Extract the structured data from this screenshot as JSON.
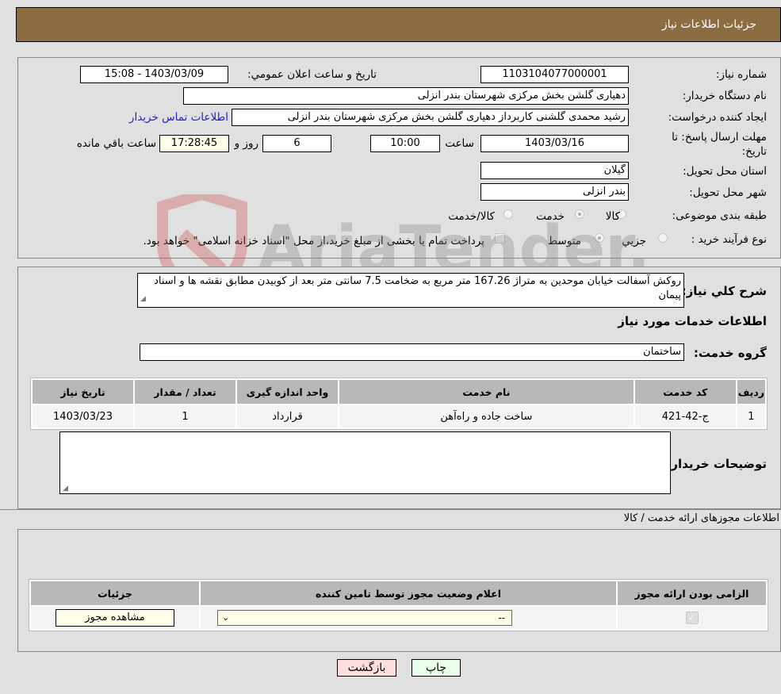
{
  "header": {
    "title": "جزئیات اطلاعات نیاز"
  },
  "info": {
    "need_number_label": "شماره نیاز:",
    "need_number": "1103104077000001",
    "announce_label": "تاريخ و ساعت اعلان عمومي:",
    "announce_value": "1403/03/09 - 15:08",
    "buyer_org_label": "نام دستگاه خریدار:",
    "buyer_org": "دهیاری گلشن بخش مرکزی شهرستان بندر انزلی",
    "creator_label": "ایجاد کننده درخواست:",
    "creator": "رشید محمدی گلشنی کاربرداز دهیاری گلشن بخش مرکزی شهرستان بندر انزلی",
    "contact_link": "اطلاعات تماس خریدار",
    "deadline_label": "مهلت ارسال پاسخ: تا تاریخ:",
    "deadline_date": "1403/03/16",
    "time_label": "ساعت",
    "deadline_time": "10:00",
    "days_value": "6",
    "days_label": "روز و",
    "remaining_time": "17:28:45",
    "remaining_label": "ساعت باقي مانده",
    "province_label": "استان محل تحویل:",
    "province": "گیلان",
    "city_label": "شهر محل تحویل:",
    "city": "بندر انزلی",
    "category_label": "طبقه بندی موضوعی:",
    "category_options": [
      "کالا",
      "خدمت",
      "کالا/خدمت"
    ],
    "category_selected": "خدمت",
    "process_label": "نوع فرآیند خرید :",
    "process_options": [
      "جزيي",
      "متوسط"
    ],
    "process_selected": "متوسط",
    "treasury_note": "پرداخت تمام یا بخشی از مبلغ خرید،از محل \"اسناد خزانه اسلامی\" خواهد بود."
  },
  "description": {
    "label": "شرح کلي نياز:",
    "text": "روکش آسفالت خیابان موحدین به متراژ 167.26 متر مربع به ضخامت 7.5 سانتی متر بعد از کوبیدن مطابق نقشه ها و اسناد پیمان",
    "services_title": "اطلاعات خدمات مورد نیاز",
    "service_group_label": "گروه خدمت:",
    "service_group": "ساختمان"
  },
  "services_table": {
    "headers": [
      "ردیف",
      "کد خدمت",
      "نام خدمت",
      "واحد اندازه گیری",
      "تعداد / مقدار",
      "تاریخ نیاز"
    ],
    "rows": [
      [
        "1",
        "ج-42-421",
        "ساخت جاده و راه‌آهن",
        "قرارداد",
        "1",
        "1403/03/23"
      ]
    ]
  },
  "buyer_notes": {
    "label": "توضیحات خریدار:",
    "text": ""
  },
  "permits": {
    "section_title": "اطلاعات مجوزهای ارائه خدمت / کالا",
    "headers": [
      "الزامی بودن ارائه مجوز",
      "اعلام وضعیت مجوز توسط تامین کننده",
      "جزئیات"
    ],
    "row": {
      "required": true,
      "status_value": "--",
      "view_button": "مشاهده مجوز"
    }
  },
  "footer": {
    "print_button": "چاپ",
    "back_button": "بازگشت"
  },
  "colors": {
    "header_bg": "#8c6d42",
    "print_bg": "#eaffea",
    "back_bg": "#ffdede",
    "link": "#2020d0"
  }
}
